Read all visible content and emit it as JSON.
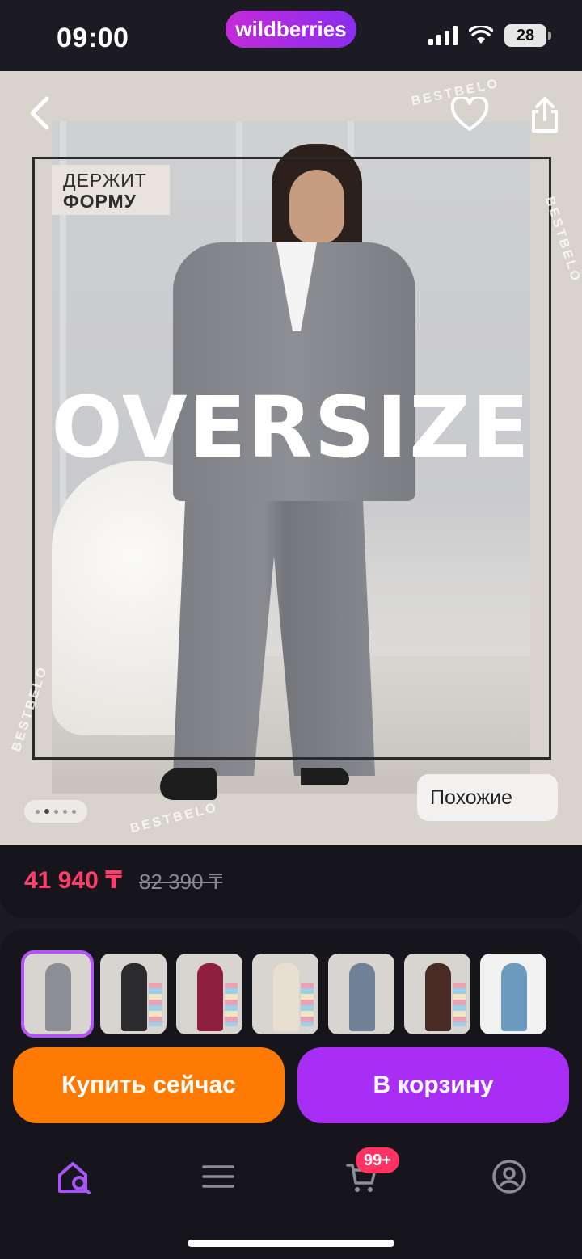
{
  "status_bar": {
    "time": "09:00",
    "brand": "wildberries",
    "battery": "28"
  },
  "product": {
    "badge_line1": "ДЕРЖИТ",
    "badge_line2": "ФОРМУ",
    "overlay_text": "OVERSIZE",
    "watermark": "BESTBELO",
    "similar_label": "Похожие",
    "gallery_page": 2,
    "gallery_total": 5
  },
  "price": {
    "current": "41 940 ₸",
    "old": "82 390 ₸"
  },
  "thumbnails": [
    {
      "name": "thumb-1",
      "color": "#8c8e94",
      "active": true
    },
    {
      "name": "thumb-2",
      "color": "#2b2b2e",
      "active": false
    },
    {
      "name": "thumb-3",
      "color": "#8e1f3e",
      "active": false
    },
    {
      "name": "thumb-4",
      "color": "#e8dfd1",
      "active": false
    },
    {
      "name": "thumb-5",
      "color": "#6f8197",
      "active": false
    },
    {
      "name": "thumb-6",
      "color": "#4a2a24",
      "active": false
    },
    {
      "name": "thumb-7",
      "color": "#6d9bbd",
      "active": false
    }
  ],
  "actions": {
    "buy_now": "Купить сейчас",
    "add_to_cart": "В корзину"
  },
  "tabbar": {
    "cart_count": "99+"
  },
  "colors": {
    "accent_purple": "#a82ef5",
    "accent_orange": "#ff7a00",
    "price_red": "#ff3d6b"
  }
}
